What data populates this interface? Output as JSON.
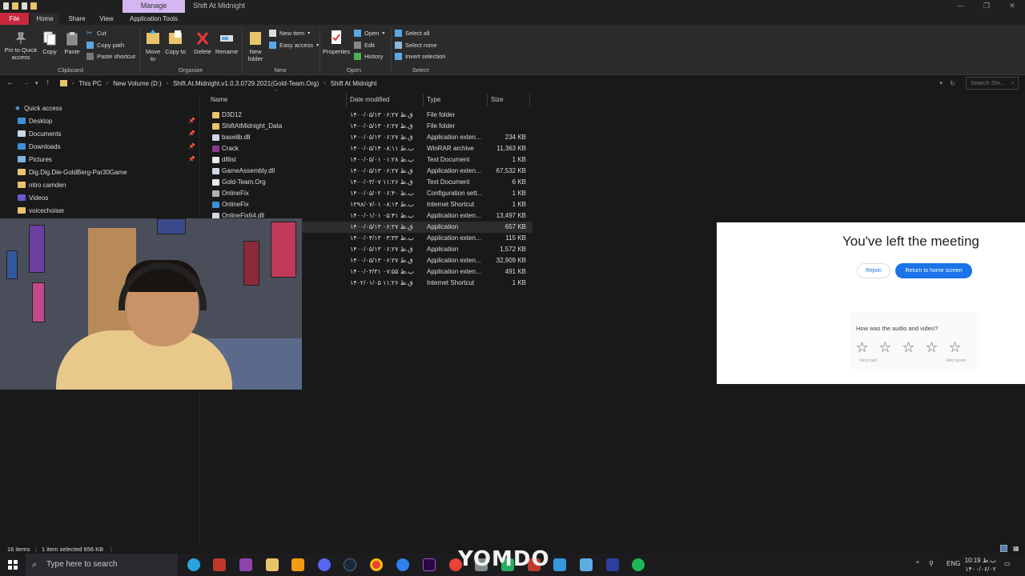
{
  "window": {
    "title": "Shift At Midnight",
    "context_tab": "Manage",
    "controls": [
      "—",
      "❐",
      "✕"
    ]
  },
  "ribbon_tabs": [
    "File",
    "Home",
    "Share",
    "View",
    "Application Tools"
  ],
  "ribbon": {
    "clipboard": {
      "pin": "Pin to Quick access",
      "copy": "Copy",
      "paste": "Paste",
      "cut": "Cut",
      "copy_path": "Copy path",
      "paste_shortcut": "Paste shortcut",
      "label": "Clipboard"
    },
    "organize": {
      "move_to": "Move to",
      "copy_to": "Copy to",
      "delete": "Delete",
      "rename": "Rename",
      "label": "Organize"
    },
    "new": {
      "new_folder": "New folder",
      "new_item": "New item",
      "easy_access": "Easy access",
      "label": "New"
    },
    "open": {
      "properties": "Properties",
      "open": "Open",
      "edit": "Edit",
      "history": "History",
      "label": "Open"
    },
    "select": {
      "select_all": "Select all",
      "select_none": "Select none",
      "invert": "Invert selection",
      "label": "Select"
    }
  },
  "address": {
    "crumbs": [
      "This PC",
      "New Volume (D:)",
      "Shift.At.Midnight.v1.0.3.0729.2021(Gold-Team.Org)",
      "Shift At Midnight"
    ],
    "search_placeholder": "Search Shi..."
  },
  "sidebar": {
    "items": [
      {
        "label": "Quick access",
        "icon": "star-icon"
      },
      {
        "label": "Desktop",
        "icon": "desktop-icon",
        "pinned": true
      },
      {
        "label": "Documents",
        "icon": "documents-icon",
        "pinned": true
      },
      {
        "label": "Downloads",
        "icon": "downloads-icon",
        "pinned": true
      },
      {
        "label": "Pictures",
        "icon": "pictures-icon",
        "pinned": true
      },
      {
        "label": "Dig.Dig.Die-GoldBerg-Par30Game",
        "icon": "folder-icon"
      },
      {
        "label": "nitro camden",
        "icon": "folder-icon"
      },
      {
        "label": "Videos",
        "icon": "videos-icon"
      },
      {
        "label": "voicechoiser",
        "icon": "folder-icon"
      }
    ],
    "pin_glyph": "📌"
  },
  "columns": {
    "name": "Name",
    "date": "Date modified",
    "type": "Type",
    "size": "Size"
  },
  "files": [
    {
      "name": "D3D12",
      "date": "۱۴۰۰/۰۵/۱۳ ق.ظ ۰۶:۲۷",
      "type": "File folder",
      "size": "",
      "icon": "folder"
    },
    {
      "name": "ShiftAtMidnight_Data",
      "date": "۱۴۰۰/۰۵/۱۳ ق.ظ ۰۶:۲۷",
      "type": "File folder",
      "size": "",
      "icon": "folder"
    },
    {
      "name": "baselib.dll",
      "date": "۱۴۰۰/۰۵/۱۳ ق.ظ ۰۶:۲۷",
      "type": "Application exten...",
      "size": "234 KB",
      "icon": "dll"
    },
    {
      "name": "Crack",
      "date": "۱۴۰۰/۰۵/۱۴ ب.ظ ۰۸:۱۱",
      "type": "WinRAR archive",
      "size": "11,363 KB",
      "icon": "rar"
    },
    {
      "name": "dlllist",
      "date": "۱۴۰۰/۰۵/۰۱ ب.ظ ۰۱:۲۸",
      "type": "Text Document",
      "size": "1 KB",
      "icon": "txt"
    },
    {
      "name": "GameAssembly.dll",
      "date": "۱۴۰۰/۰۵/۱۳ ق.ظ ۰۶:۲۷",
      "type": "Application exten...",
      "size": "67,532 KB",
      "icon": "dll"
    },
    {
      "name": "Gold-Team.Org",
      "date": "۱۴۰۰/۰۳/۰۷ ق.ظ ۱۱:۲۶",
      "type": "Text Document",
      "size": "6 KB",
      "icon": "txt"
    },
    {
      "name": "OnlineFix",
      "date": "۱۴۰۰/۰۵/۰۲ ب.ظ ۰۶:۴۰",
      "type": "Configuration sett...",
      "size": "1 KB",
      "icon": "cfg"
    },
    {
      "name": "OnlineFix",
      "date": "۱۳۹۸/۰۷/۰۱ ب.ظ ۰۸:۱۴",
      "type": "Internet Shortcut",
      "size": "1 KB",
      "icon": "url"
    },
    {
      "name": "OnlineFix64.dll",
      "date": "۱۴۰۰/۰۱/۰۱ ب.ظ ۰۵:۴۱",
      "type": "Application exten...",
      "size": "13,497 KB",
      "icon": "dll"
    },
    {
      "name": "",
      "date": "۱۴۰۰/۰۵/۱۳ ق.ظ ۰۶:۲۷",
      "type": "Application",
      "size": "657 KB",
      "icon": "exe",
      "selected": true
    },
    {
      "name": "",
      "date": "۱۴۰۰/۰۴/۱۳ ب.ظ ۰۳:۳۳",
      "type": "Application exten...",
      "size": "115 KB",
      "icon": "dll"
    },
    {
      "name": "",
      "date": "۱۴۰۰/۰۵/۱۳ ق.ظ ۰۶:۲۷",
      "type": "Application",
      "size": "1,572 KB",
      "icon": "exe"
    },
    {
      "name": "",
      "date": "۱۴۰۰/۰۵/۱۳ ق.ظ ۰۶:۲۷",
      "type": "Application exten...",
      "size": "32,909 KB",
      "icon": "dll"
    },
    {
      "name": "",
      "date": "۱۴۰۰/۰۳/۳۱ ب.ظ ۰۷:۵۵",
      "type": "Application exten...",
      "size": "491 KB",
      "icon": "dll"
    },
    {
      "name": "",
      "date": "۱۴۰۲/۰۱/۰۵ ق.ظ ۱۱:۲۶",
      "type": "Internet Shortcut",
      "size": "1 KB",
      "icon": "url"
    }
  ],
  "meet": {
    "title": "You've left the meeting",
    "rejoin": "Rejoin",
    "home": "Return to home screen",
    "question": "How was the audio and video?",
    "star": "☆",
    "low_label": "Very bad",
    "high_label": "Very good"
  },
  "status": {
    "items": "16 items",
    "selected": "1 item selected  656 KB"
  },
  "taskbar": {
    "search_placeholder": "Type here to search",
    "watermark": "YOMDO",
    "lang": "ENG",
    "time": "10:19 ب.ظ",
    "date": "۱۴۰۰/۰۶/۰۲"
  },
  "colors": {
    "file_tab": "#c7283e",
    "manage_tab": "#d4b6f0",
    "meet_primary": "#1a73e8",
    "folder": "#e9c46a"
  }
}
